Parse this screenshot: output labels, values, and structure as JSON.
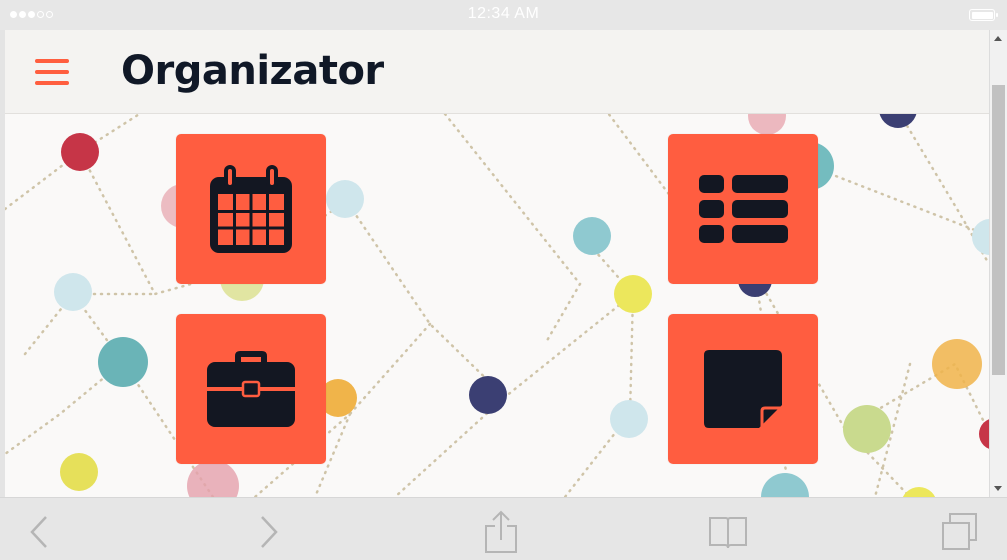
{
  "status_bar": {
    "time": "12:34 AM",
    "signal_bars_filled": 3,
    "signal_bars_total": 5,
    "battery_level": 1.0
  },
  "header": {
    "title": "Organizator",
    "menu_icon": "hamburger-menu-icon"
  },
  "tiles": [
    {
      "name": "calendar",
      "icon": "calendar-icon"
    },
    {
      "name": "list",
      "icon": "list-icon"
    },
    {
      "name": "briefcase",
      "icon": "briefcase-icon"
    },
    {
      "name": "note",
      "icon": "sticky-note-icon"
    }
  ],
  "toolbar": {
    "back_icon": "chevron-left-icon",
    "forward_icon": "chevron-right-icon",
    "share_icon": "share-icon",
    "bookmarks_icon": "book-icon",
    "tabs_icon": "tabs-icon"
  },
  "colors": {
    "accent": "#ff5d40",
    "title": "#101827",
    "icon_dark": "#131722",
    "header_bg": "#f4f3f1",
    "chrome_bg": "#e6e6e6"
  }
}
